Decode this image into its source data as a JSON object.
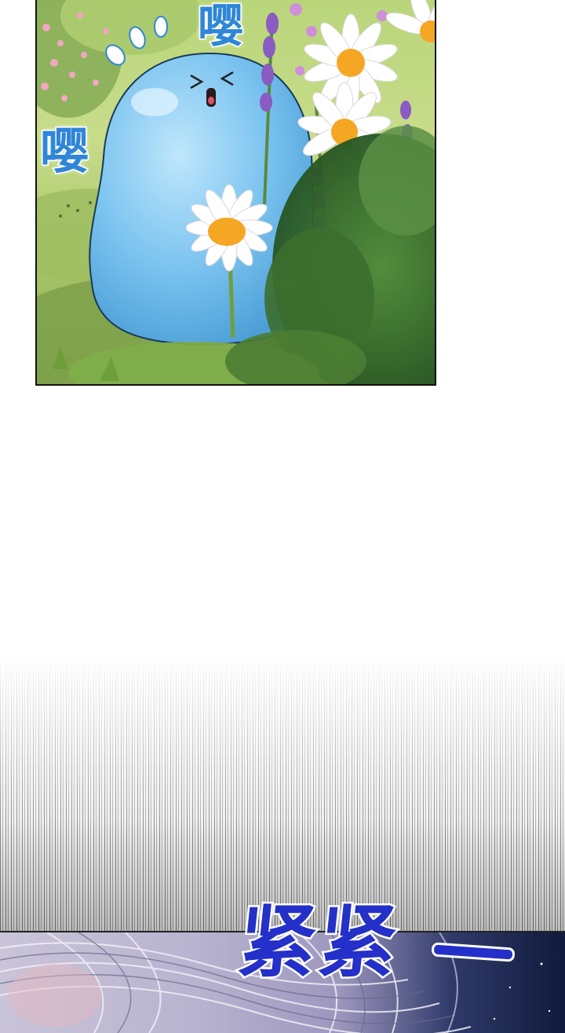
{
  "panels": {
    "top": {
      "sfx_top": "嘤",
      "sfx_left": "嘤"
    },
    "bottom": {
      "sfx_main": "紧紧"
    }
  },
  "colors": {
    "sfx_light_blue": "#2f86d8",
    "sfx_dark_blue": "#2430c8",
    "slime_blue": "#7cc4f0",
    "daisy_center": "#f5a623"
  },
  "icons": [
    "slime-character",
    "daisy-flower",
    "lavender-flower",
    "bush-foliage"
  ]
}
